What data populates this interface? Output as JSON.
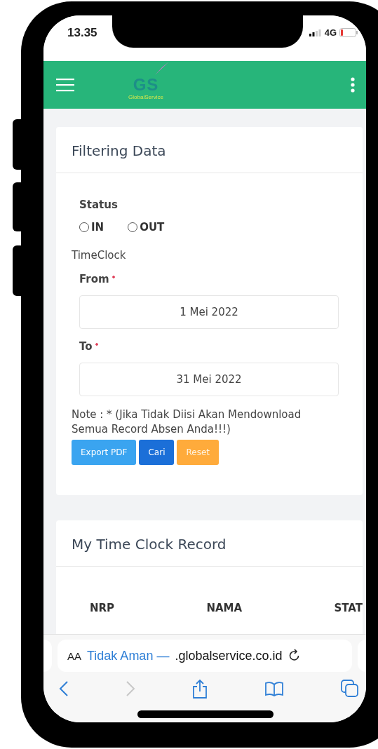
{
  "status_bar": {
    "time": "13.35",
    "network": "4G"
  },
  "header": {
    "logo": "GS",
    "logo_tagline": "GlobalService"
  },
  "filter_card": {
    "title": "Filtering Data",
    "status_label": "Status",
    "status_options": [
      {
        "label": "IN",
        "selected": false
      },
      {
        "label": "OUT",
        "selected": false
      }
    ],
    "timeclock_label": "TimeClock",
    "fields": [
      {
        "label": "From",
        "required": true,
        "value": "1 Mei 2022"
      },
      {
        "label": "To",
        "required": true,
        "value": "31 Mei 2022"
      }
    ],
    "note": "Note : * (Jika Tidak Diisi Akan Mendownload Semua Record Absen Anda!!!)",
    "buttons": [
      {
        "label": "Export PDF",
        "kind": "info"
      },
      {
        "label": "Cari",
        "kind": "primary"
      },
      {
        "label": "Reset",
        "kind": "warning"
      }
    ]
  },
  "record_card": {
    "title": "My Time Clock Record",
    "columns": [
      "NRP",
      "NAMA",
      "STAT"
    ]
  },
  "browser": {
    "text_size": "AA",
    "security": "Tidak Aman —",
    "url": ".globalservice.co.id"
  }
}
